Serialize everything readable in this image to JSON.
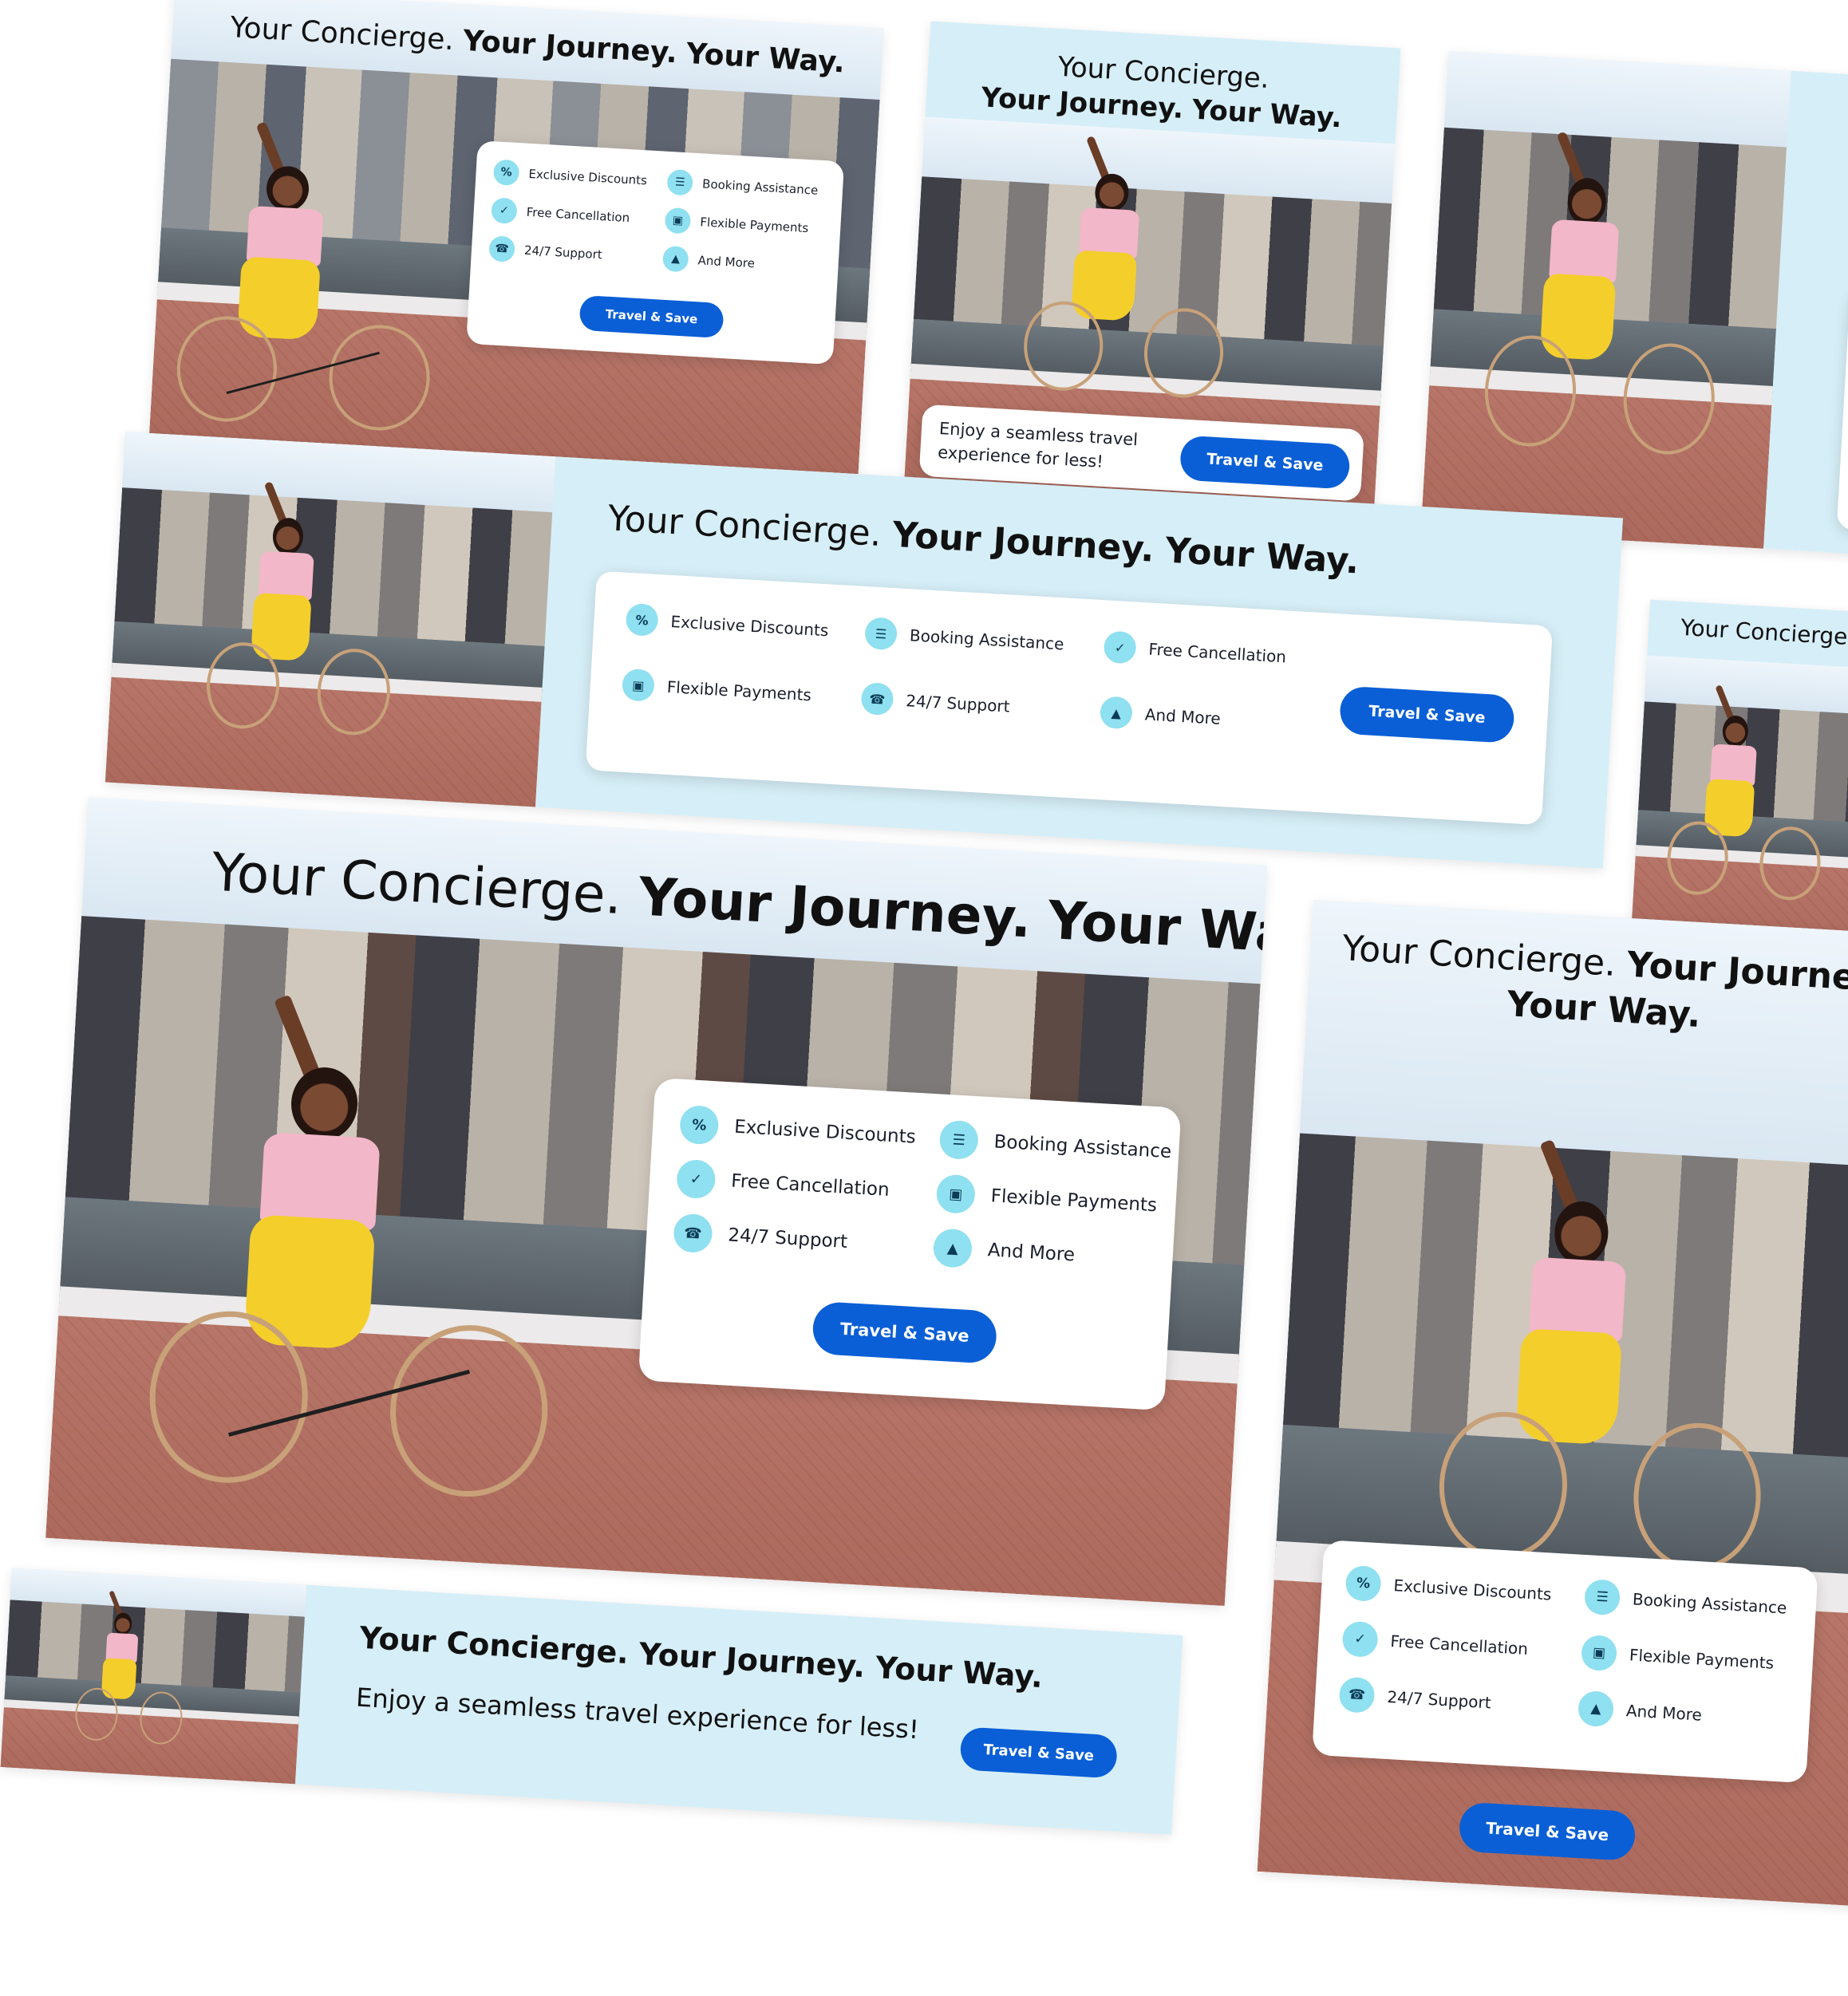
{
  "headline": {
    "part1": "Your Concierge.",
    "part2": "Your Journey.",
    "part3": "Your Way.",
    "bold_line": "Your Concierge. Your Journey. Your Way.",
    "cut_part2": "Y",
    "cut_part3": "Yo"
  },
  "features": {
    "discounts": "Exclusive Discounts",
    "booking": "Booking Assistance",
    "cancellation": "Free Cancellation",
    "payments": "Flexible Payments",
    "support": "24/7 Support",
    "more": "And More"
  },
  "tagline": "Enjoy a seamless travel experience for less!",
  "cta": "Travel & Save",
  "icons": {
    "discounts": "percent-badge-icon",
    "booking": "chat-bubble-icon",
    "cancellation": "shield-check-icon",
    "payments": "wallet-icon",
    "support": "phone-icon",
    "more": "thumbs-up-icon"
  },
  "colors": {
    "accent": "#0a5fd6",
    "panel": "#d6eef7",
    "icon_bg": "#8fe0f0"
  }
}
